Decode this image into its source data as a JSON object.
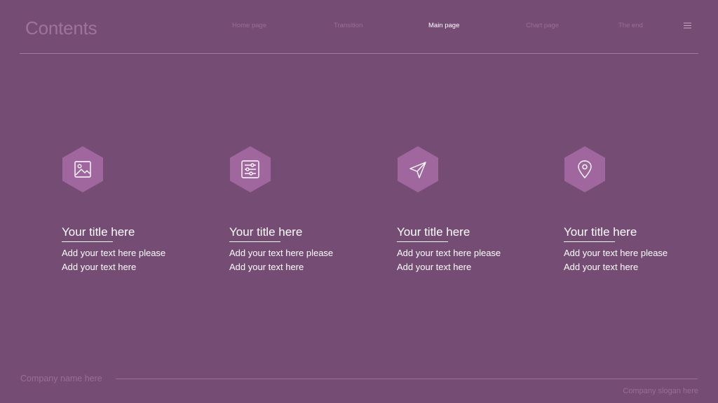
{
  "header": {
    "title": "Contents",
    "nav": [
      {
        "label": "Home  page",
        "active": false
      },
      {
        "label": "Transition",
        "active": false
      },
      {
        "label": "Main page",
        "active": true
      },
      {
        "label": "Chart page",
        "active": false
      },
      {
        "label": "The end",
        "active": false
      }
    ],
    "menu_icon": "hamburger-menu-icon"
  },
  "cards": [
    {
      "icon": "image-icon",
      "title": "Your title here",
      "text": "Add your text here please Add your text here"
    },
    {
      "icon": "sliders-icon",
      "title": "Your title here",
      "text": "Add your text here please Add your text here"
    },
    {
      "icon": "send-icon",
      "title": "Your title here",
      "text": "Add your text here please Add your text here"
    },
    {
      "icon": "location-pin-icon",
      "title": "Your title here",
      "text": "Add your text here please Add your text here"
    }
  ],
  "footer": {
    "company": "Company name here",
    "slogan": "Company slogan here"
  },
  "colors": {
    "background": "#744c74",
    "hexagon": "#a0679e",
    "accent_text": "#ffffff",
    "muted_text": "#9a6e98"
  }
}
